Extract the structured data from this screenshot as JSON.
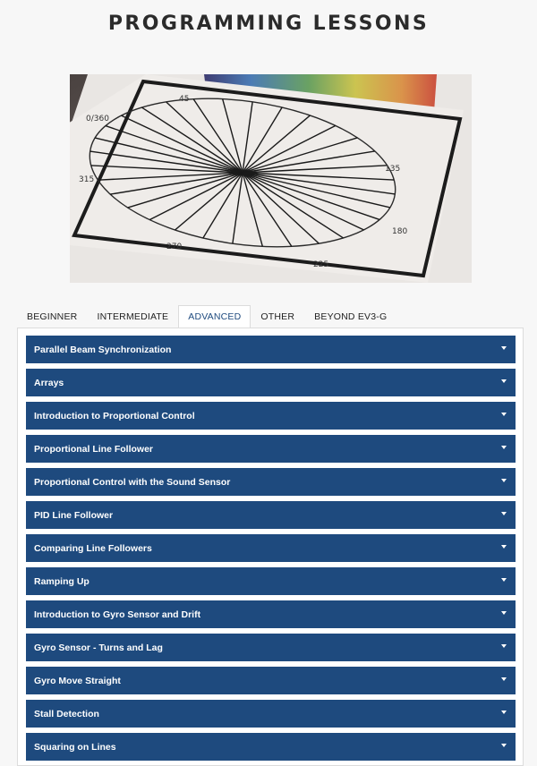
{
  "page": {
    "title": "PROGRAMMING LESSONS"
  },
  "hero": {
    "alt": "Protractor angle chart",
    "dial_labels": [
      "0/360",
      "45",
      "135",
      "180",
      "225",
      "270",
      "315"
    ]
  },
  "tabs": [
    {
      "label": "BEGINNER",
      "active": false
    },
    {
      "label": "INTERMEDIATE",
      "active": false
    },
    {
      "label": "ADVANCED",
      "active": true
    },
    {
      "label": "OTHER",
      "active": false
    },
    {
      "label": "BEYOND EV3-G",
      "active": false
    }
  ],
  "lessons": [
    "Parallel Beam Synchronization",
    "Arrays",
    "Introduction to Proportional Control",
    "Proportional Line Follower",
    "Proportional Control with the Sound Sensor",
    "PID Line Follower",
    "Comparing Line Followers",
    "Ramping Up",
    "Introduction to Gyro Sensor and Drift",
    "Gyro Sensor - Turns and Lag",
    "Gyro Move Straight",
    "Stall Detection",
    "Squaring on Lines"
  ],
  "colors": {
    "accent": "#1e4a7e",
    "text": "#2b2b2b",
    "background": "#f7f7f7"
  }
}
